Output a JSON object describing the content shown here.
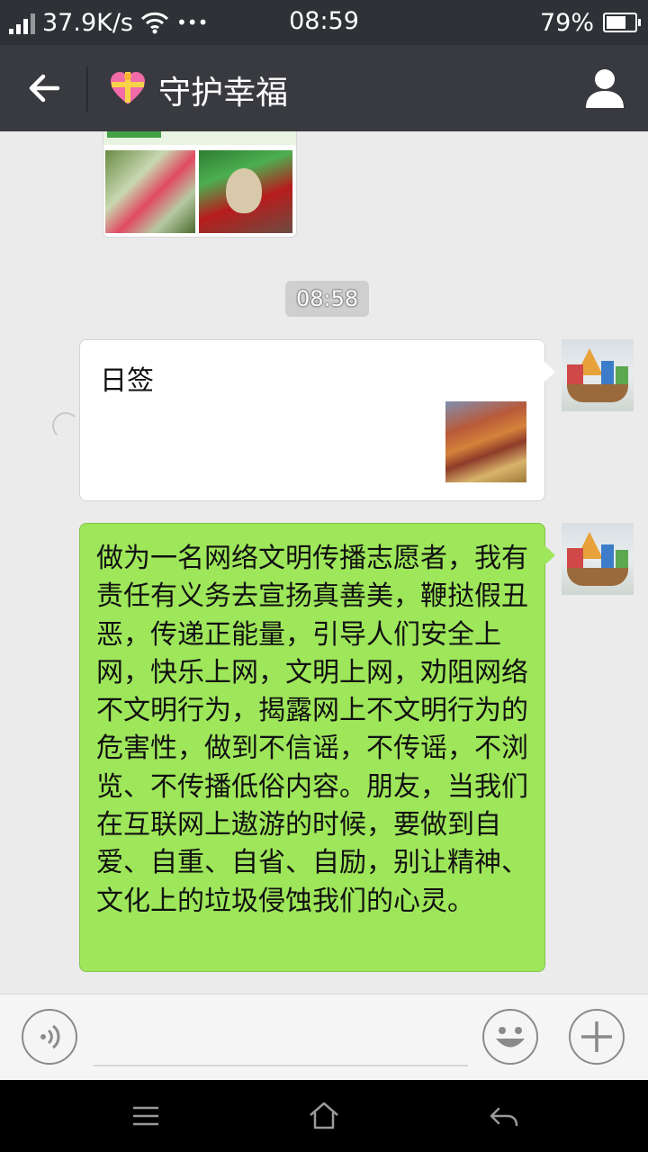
{
  "status_bar": {
    "network_speed": "37.9K/s",
    "dots": "•••",
    "time": "08:59",
    "battery_percent": "79%",
    "battery_level": 0.79,
    "icons": [
      "signal-icon",
      "wifi-icon",
      "battery-icon"
    ]
  },
  "title_bar": {
    "back_icon": "back-arrow-icon",
    "title_emoji_icon": "gift-heart-icon",
    "title": "守护幸福",
    "profile_icon": "person-icon"
  },
  "chat": {
    "timestamp": "08:58",
    "link_card": {
      "title": "日签"
    },
    "text_message": "做为一名网络文明传播志愿者，我有责任有义务去宣扬真善美，鞭挞假丑恶，传递正能量，引导人们安全上网，快乐上网，文明上网，劝阻网络不文明行为，揭露网上不文明行为的危害性，做到不信谣，不传谣，不浏览、不传播低俗内容。朋友，当我们在互联网上遨游的时候，要做到自爱、自重、自省、自励，别让精神、文化上的垃圾侵蚀我们的心灵。"
  },
  "input_bar": {
    "voice_icon": "voice-icon",
    "emoji_icon": "smiley-icon",
    "plus_icon": "plus-icon"
  },
  "nav_bar": {
    "icons": [
      "menu-icon",
      "home-icon",
      "back-icon"
    ]
  },
  "colors": {
    "title_bar": "#393a3f",
    "status_bar": "#2e3236",
    "chat_background": "#ebebeb",
    "green_bubble": "#9ee65a"
  }
}
